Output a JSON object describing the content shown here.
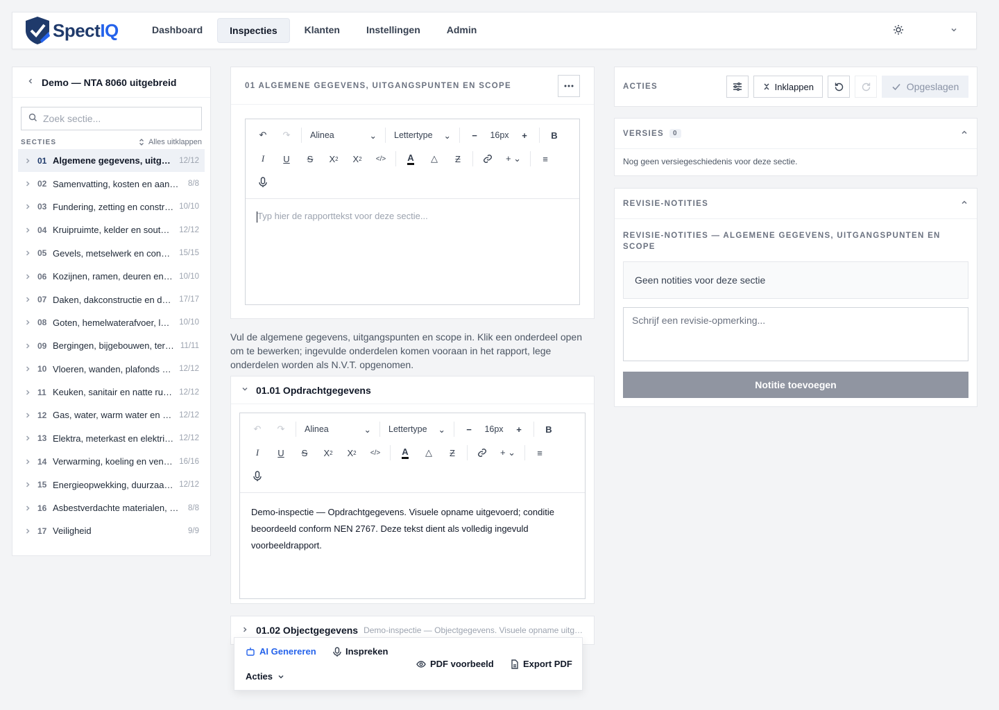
{
  "app": {
    "logo_main": "Spect",
    "logo_accent": "IQ",
    "nav": [
      {
        "label": "Dashboard"
      },
      {
        "label": "Inspecties"
      },
      {
        "label": "Klanten"
      },
      {
        "label": "Instellingen"
      },
      {
        "label": "Admin"
      }
    ]
  },
  "sidebar": {
    "title": "Demo — NTA 8060 uitgebreid",
    "search_placeholder": "Zoek sectie...",
    "sections_label": "SECTIES",
    "expand_all": "Alles uitklappen",
    "items": [
      {
        "num": "01",
        "name": "Algemene gegevens, uitgangspunten en scope",
        "count": "12/12"
      },
      {
        "num": "02",
        "name": "Samenvatting, kosten en aanbevelingen",
        "count": "8/8"
      },
      {
        "num": "03",
        "name": "Fundering, zetting en constructie",
        "count": "10/10"
      },
      {
        "num": "04",
        "name": "Kruipruimte, kelder en souterrain",
        "count": "12/12"
      },
      {
        "num": "05",
        "name": "Gevels, metselwerk en constructie",
        "count": "15/15"
      },
      {
        "num": "06",
        "name": "Kozijnen, ramen, deuren en beglazing",
        "count": "10/10"
      },
      {
        "num": "07",
        "name": "Daken, dakconstructie en dakbedekking",
        "count": "17/17"
      },
      {
        "num": "08",
        "name": "Goten, hemelwaterafvoer, lood en zink",
        "count": "10/10"
      },
      {
        "num": "09",
        "name": "Bergingen, bijgebouwen, terreinen",
        "count": "11/11"
      },
      {
        "num": "10",
        "name": "Vloeren, wanden, plafonds en trappen",
        "count": "12/12"
      },
      {
        "num": "11",
        "name": "Keuken, sanitair en natte ruimtes",
        "count": "12/12"
      },
      {
        "num": "12",
        "name": "Gas, water, warm water en riolering",
        "count": "12/12"
      },
      {
        "num": "13",
        "name": "Elektra, meterkast en elektrische installatie",
        "count": "12/12"
      },
      {
        "num": "14",
        "name": "Verwarming, koeling en ventilatie",
        "count": "16/16"
      },
      {
        "num": "15",
        "name": "Energieopwekking, duurzaamheid",
        "count": "12/12"
      },
      {
        "num": "16",
        "name": "Asbestverdachte materialen, milieu",
        "count": "8/8"
      },
      {
        "num": "17",
        "name": "Veiligheid",
        "count": "9/9"
      }
    ]
  },
  "main": {
    "section_title": "01 ALGEMENE GEGEVENS, UITGANGSPUNTEN EN SCOPE",
    "editor": {
      "paragraph": "Alinea",
      "font": "Lettertype",
      "size": "16px",
      "placeholder": "Typ hier de rapporttekst voor deze sectie..."
    },
    "helper": "Vul de algemene gegevens, uitgangspunten en scope in. Klik een onderdeel open om te bewerken; ingevulde onderdelen komen vooraan in het rapport, lege onderdelen worden als N.V.T. opgenomen.",
    "sub1": {
      "title": "01.01 Opdrachtgegevens",
      "text": "Demo-inspectie — Opdrachtgegevens. Visuele opname uitgevoerd; conditie beoordeeld conform NEN 2767. Deze tekst dient als volledig ingevuld voorbeeldrapport."
    },
    "sub2": {
      "title": "01.02 Objectgegevens",
      "preview": "Demo-inspectie — Objectgegevens. Visuele opname uitgevoerd"
    }
  },
  "floatbar": {
    "ai": "AI Genereren",
    "speak": "Inspreken",
    "actions": "Acties",
    "pdf_preview": "PDF voorbeeld",
    "export": "Export PDF"
  },
  "right": {
    "acties_label": "ACTIES",
    "collapse": "Inklappen",
    "saved": "Opgeslagen",
    "versions_label": "VERSIES",
    "versions_count": "0",
    "versions_empty": "Nog geen versiegeschiedenis voor deze sectie.",
    "revision_label": "REVISIE-NOTITIES",
    "revision_sub": "REVISIE-NOTITIES — ALGEMENE GEGEVENS, UITGANGSPUNTEN EN SCOPE",
    "no_notes": "Geen notities voor deze sectie",
    "note_placeholder": "Schrijf een revisie-opmerking...",
    "add_note": "Notitie toevoegen"
  },
  "colors": {
    "brand": "#1f3a6b",
    "accent": "#2563eb",
    "button_disabled": "#9095a1"
  }
}
